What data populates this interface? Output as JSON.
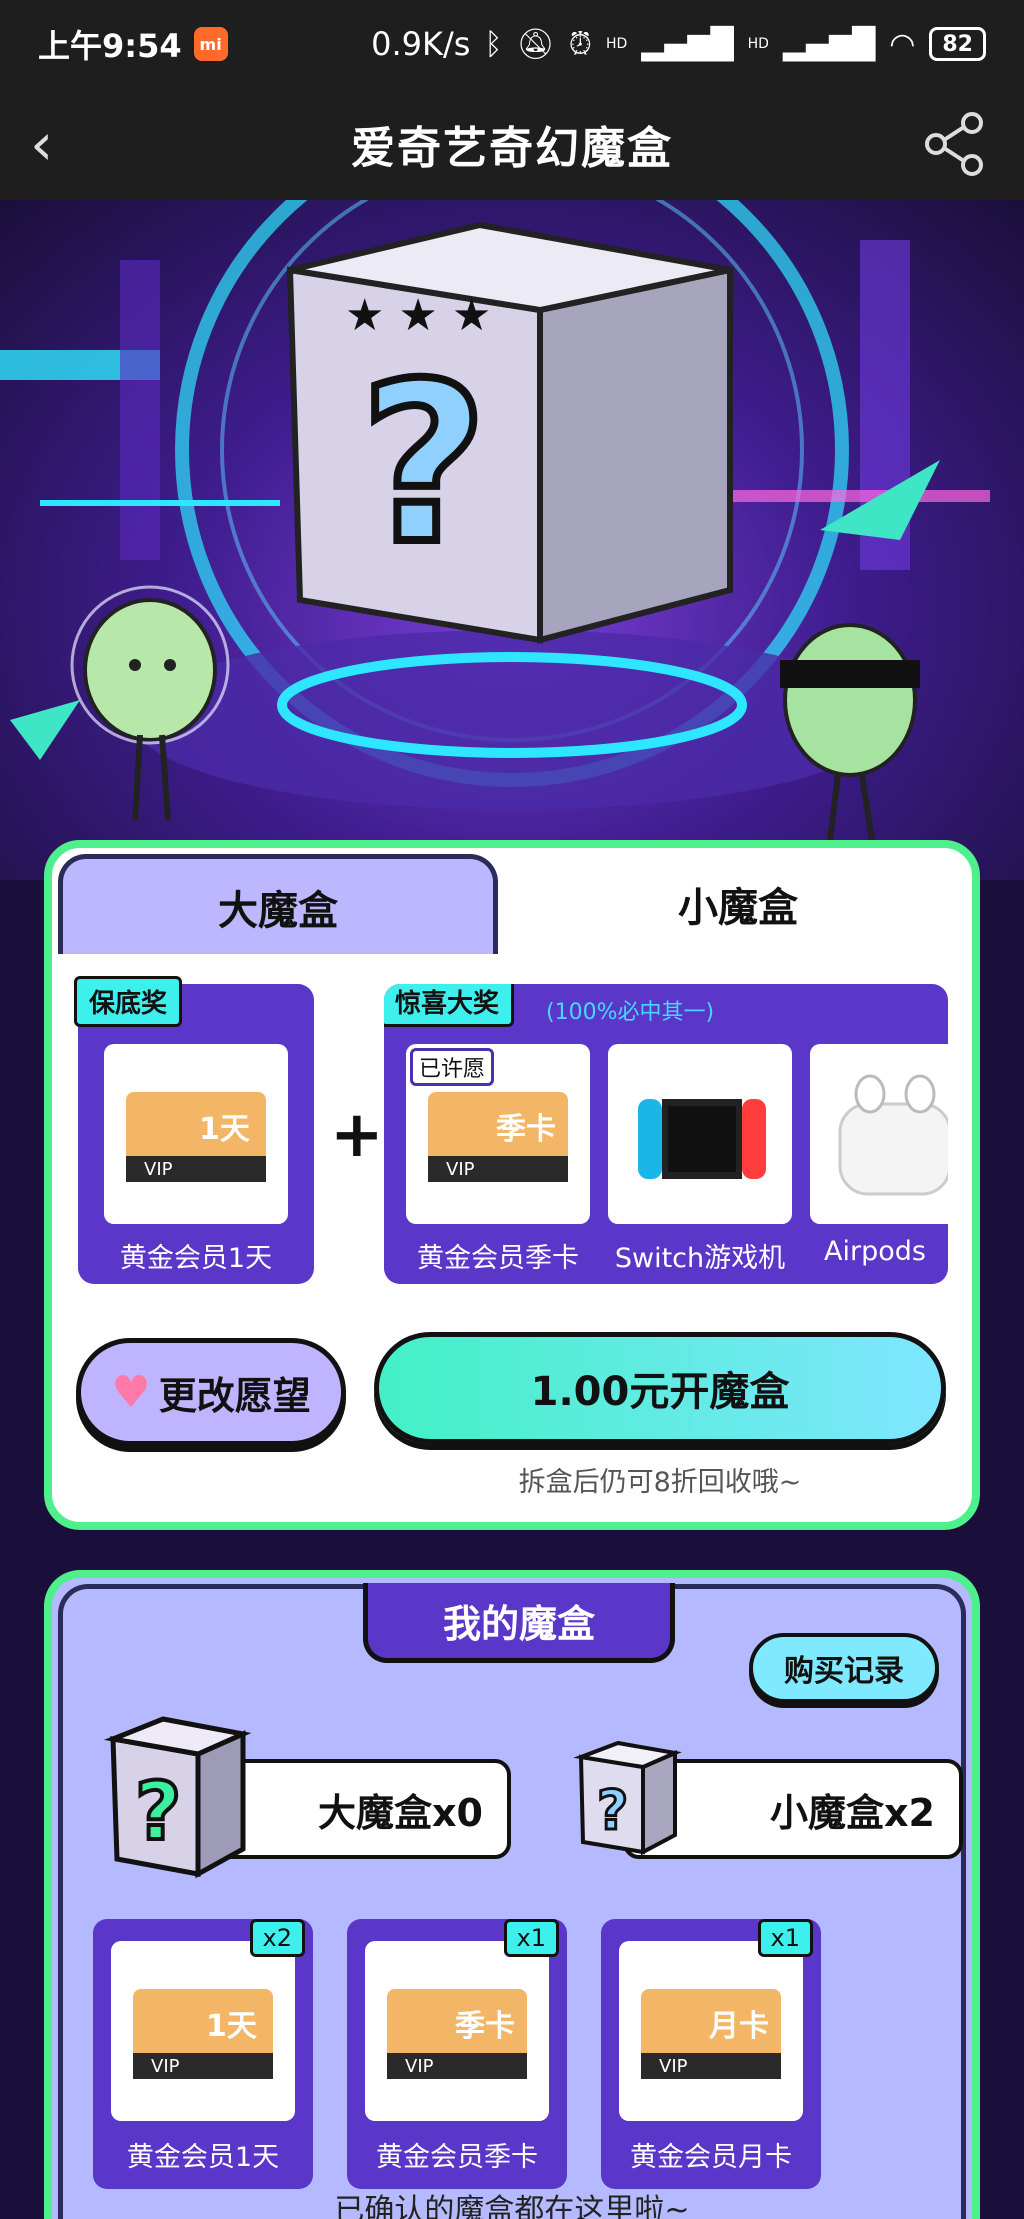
{
  "status_bar": {
    "time": "上午9:54",
    "app_icon_text": "mi",
    "network_speed": "0.9K/s",
    "signal_1": "HD",
    "signal_2": "HD",
    "battery": "82"
  },
  "nav": {
    "back_icon": "chevron-left-icon",
    "title": "爱奇艺奇幻魔盒",
    "share_icon": "share-icon"
  },
  "tabs": {
    "big": "大魔盒",
    "small": "小魔盒",
    "active": "small"
  },
  "guaranteed": {
    "tag": "保底奖",
    "item": {
      "label": "黄金会员1天",
      "card_text": "1天"
    }
  },
  "surprise": {
    "tag": "惊喜大奖",
    "note": "(100%必中其一)",
    "items": [
      {
        "label": "黄金会员季卡",
        "card_text": "季卡",
        "badge": "已许愿"
      },
      {
        "label": "Switch游戏机"
      },
      {
        "label": "Airpods"
      }
    ]
  },
  "actions": {
    "change_wish": "更改愿望",
    "open_box": "1.00元开魔盒",
    "recycle_note": "拆盒后仍可8折回收哦~"
  },
  "my_box": {
    "title": "我的魔盒",
    "history_button": "购买记录",
    "big_count": "大魔盒x0",
    "small_count": "小魔盒x2",
    "owned": [
      {
        "label": "黄金会员1天",
        "qty": "x2",
        "card_text": "1天"
      },
      {
        "label": "黄金会员季卡",
        "qty": "x1",
        "card_text": "季卡"
      },
      {
        "label": "黄金会员月卡",
        "qty": "x1",
        "card_text": "月卡"
      }
    ],
    "bottom_note": "已确认的魔盒都在这里啦~"
  },
  "colors": {
    "accent_green": "#4ef08b",
    "purple": "#5a37c9",
    "cyan": "#3df0ee",
    "lavender": "#b5b9ff"
  }
}
